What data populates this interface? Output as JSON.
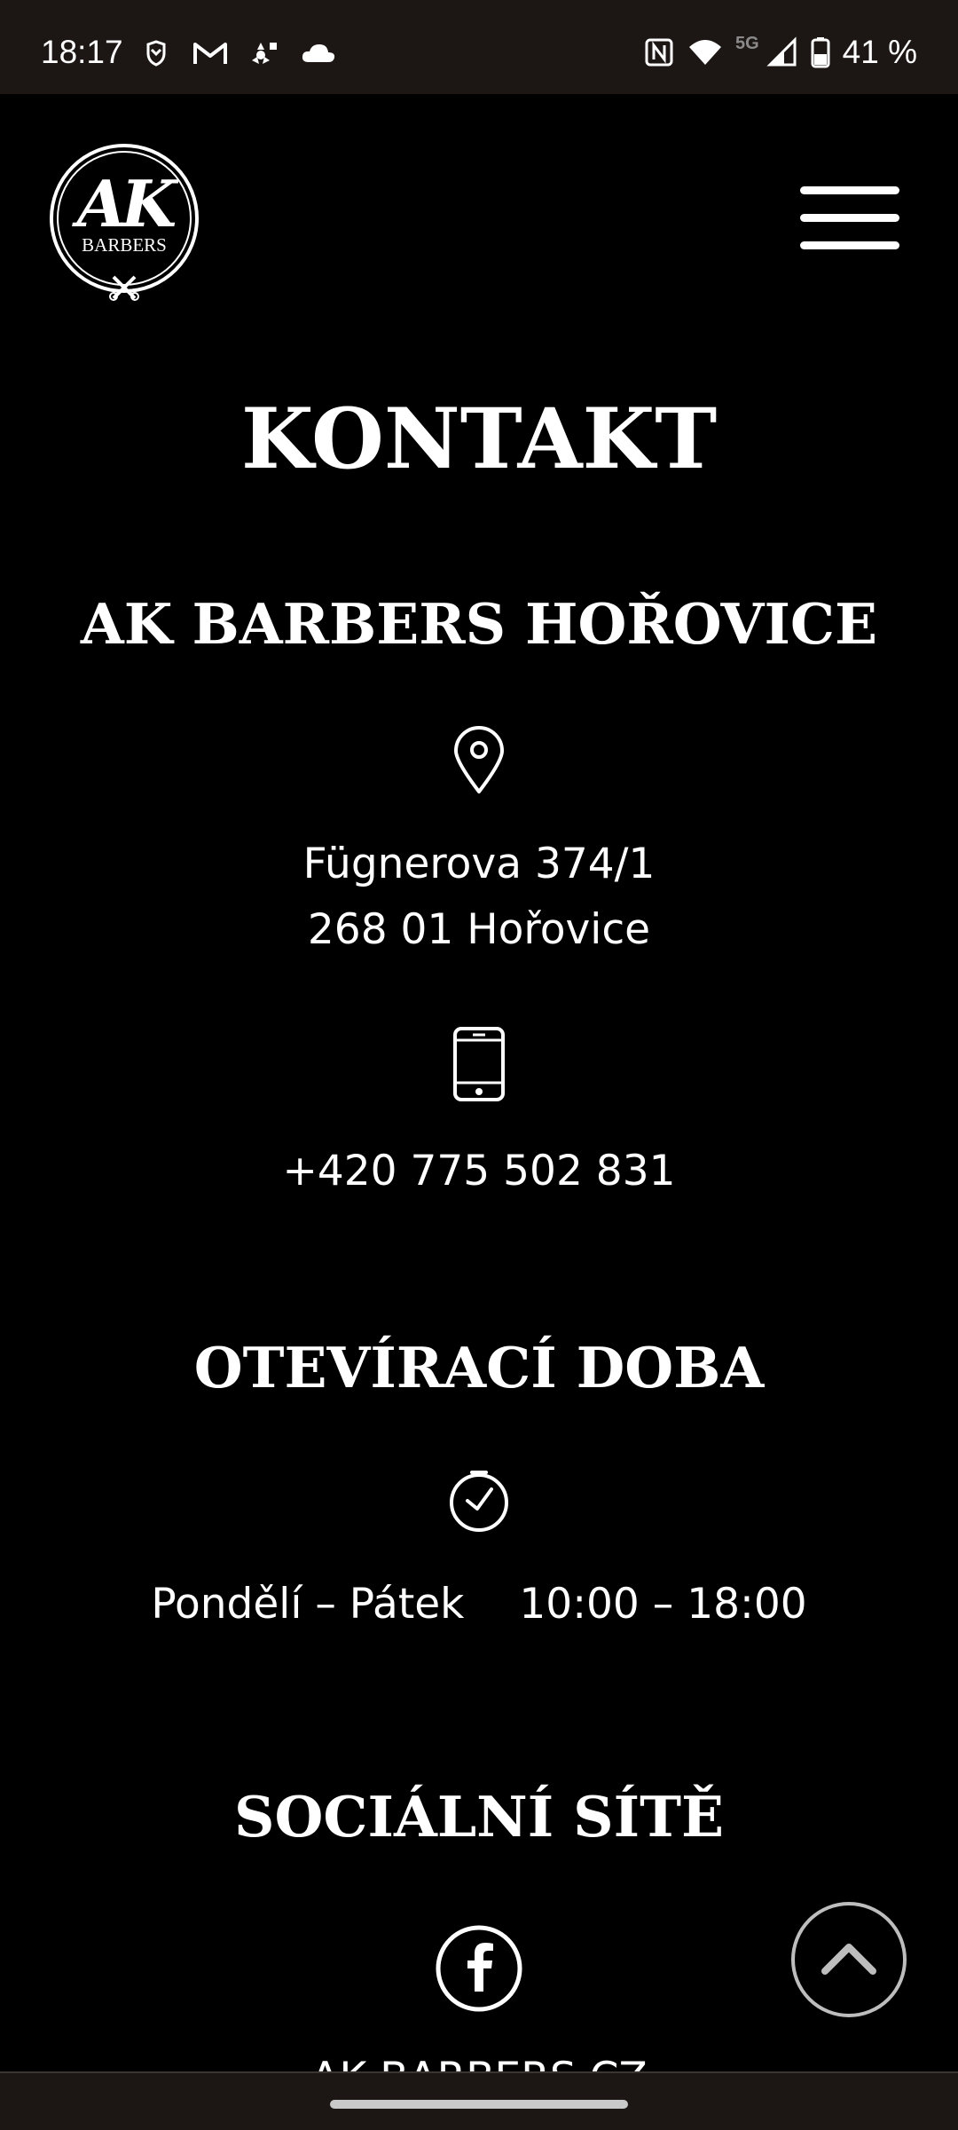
{
  "status_bar": {
    "time": "18:17",
    "network": "5G",
    "battery": "41 %",
    "left_icons": [
      "shield-icon",
      "gmail-icon",
      "fan-icon",
      "cloud-icon"
    ],
    "right_icons": [
      "nfc-icon",
      "wifi-icon",
      "signal-icon",
      "battery-icon"
    ]
  },
  "header": {
    "logo_text": "AK",
    "logo_subtext": "BARBERS",
    "menu_icon": "hamburger-menu-icon"
  },
  "page": {
    "title": "KONTAKT"
  },
  "location": {
    "heading": "AK BARBERS HOŘOVICE",
    "icon": "location-pin-icon",
    "street": "Fügnerova 374/1",
    "city": "268 01 Hořovice",
    "phone_icon": "smartphone-icon",
    "phone": "+420 775 502 831"
  },
  "hours": {
    "heading": "OTEVÍRACÍ DOBA",
    "icon": "clock-icon",
    "days": "Pondělí – Pátek",
    "time": "10:00 – 18:00"
  },
  "social": {
    "heading": "SOCIÁLNÍ SÍTĚ",
    "icon": "facebook-icon",
    "facebook_label": "AK BARBERS CZ"
  },
  "controls": {
    "scroll_top_icon": "chevron-up-icon"
  },
  "colors": {
    "background": "#000000",
    "text": "#ffffff",
    "system_bar": "#1c1714",
    "scroll_button_border": "#bdbdbd"
  }
}
